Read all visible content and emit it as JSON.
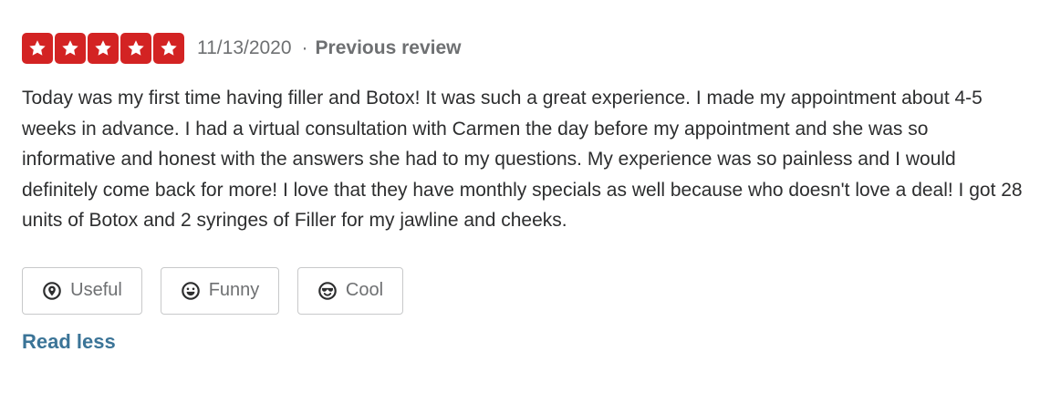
{
  "review": {
    "rating": 5,
    "max_rating": 5,
    "star_color": "#d32323",
    "date": "11/13/2020",
    "separator": "·",
    "previous_label": "Previous review",
    "text": "Today was my first time having filler and Botox! It was such a great experience. I made my appointment about 4-5 weeks in advance. I had a virtual consultation with Carmen the day before my appointment and she was so informative and honest with the answers she had to my questions. My experience was so painless and I would definitely come back for more! I love that they have monthly specials as well because who doesn't love a deal! I got 28 units of Botox and 2 syringes of Filler for my jawline and cheeks.",
    "reactions": [
      {
        "label": "Useful",
        "icon": "useful-icon"
      },
      {
        "label": "Funny",
        "icon": "funny-icon"
      },
      {
        "label": "Cool",
        "icon": "cool-icon"
      }
    ],
    "read_less_label": "Read less",
    "link_color": "#3b7497"
  }
}
